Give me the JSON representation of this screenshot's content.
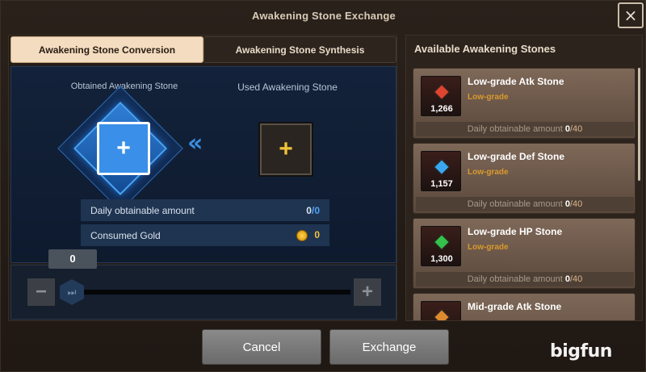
{
  "window": {
    "title": "Awakening Stone Exchange",
    "close_icon": "×"
  },
  "tabs": [
    {
      "label": "Awakening Stone Conversion",
      "active": true
    },
    {
      "label": "Awakening Stone Synthesis",
      "active": false
    }
  ],
  "conversion": {
    "obtained_label": "Obtained Awakening Stone",
    "used_label": "Used Awakening Stone",
    "obtained_slot_icon": "+",
    "used_slot_icon": "+",
    "arrow_icon": "«",
    "daily_label": "Daily obtainable amount",
    "daily_current": "0",
    "daily_sep": "/",
    "daily_max": "0",
    "gold_label": "Consumed Gold",
    "gold_value": "0"
  },
  "slider": {
    "value": "0",
    "minus_icon": "−",
    "plus_icon": "+",
    "knob_icon": "⏭"
  },
  "stones_panel": {
    "title": "Available Awakening Stones",
    "daily_label": "Daily obtainable amount",
    "items": [
      {
        "name": "Low-grade Atk Stone",
        "grade": "Low-grade",
        "count": "1,266",
        "daily_current": "0",
        "daily_max": "/40",
        "gem_color": "#e0442f"
      },
      {
        "name": "Low-grade Def Stone",
        "grade": "Low-grade",
        "count": "1,157",
        "daily_current": "0",
        "daily_max": "/40",
        "gem_color": "#3aa8f0"
      },
      {
        "name": "Low-grade HP Stone",
        "grade": "Low-grade",
        "count": "1,300",
        "daily_current": "0",
        "daily_max": "/40",
        "gem_color": "#35c24a"
      },
      {
        "name": "Mid-grade Atk Stone",
        "grade": "",
        "count": "",
        "daily_current": "",
        "daily_max": "",
        "gem_color": "#e08a2f"
      }
    ]
  },
  "buttons": {
    "cancel": "Cancel",
    "exchange": "Exchange"
  },
  "watermark": "bigfun"
}
